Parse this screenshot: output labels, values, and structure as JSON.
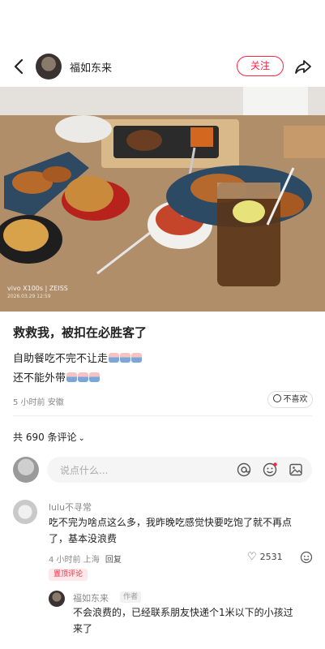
{
  "header": {
    "author_name": "福如东来",
    "follow_label": "关注"
  },
  "photo": {
    "watermark_brand": "vivo X100s | ZEISS",
    "watermark_time": "2026.03.29 12:59"
  },
  "post": {
    "title": "救救我，被扣在必胜客了",
    "line1": "自助餐吃不完不让走",
    "line2": "还不能外带",
    "time": "5 小时前",
    "location": "安徽",
    "dislike_label": "不喜欢"
  },
  "comments": {
    "count_label": "共 690 条评论",
    "input_placeholder": "说点什么...",
    "items": [
      {
        "user": "lulu不寻常",
        "text_line1": "吃不完为啥点这么多，我昨晚吃感觉快要吃饱了就不再点",
        "text_line2": "了，基本没浪费",
        "time": "4 小时前",
        "location": "上海",
        "reply_label": "回复",
        "likes": "2531",
        "badge": "置顶评论"
      }
    ],
    "reply": {
      "user": "福如东来",
      "tag": "作者",
      "text_line1": "不会浪费的，已经联系朋友快递个1米以下的小孩过",
      "text_line2": "来了"
    }
  },
  "colors": {
    "accent": "#ff2442",
    "text": "#222222",
    "muted": "#888888"
  }
}
